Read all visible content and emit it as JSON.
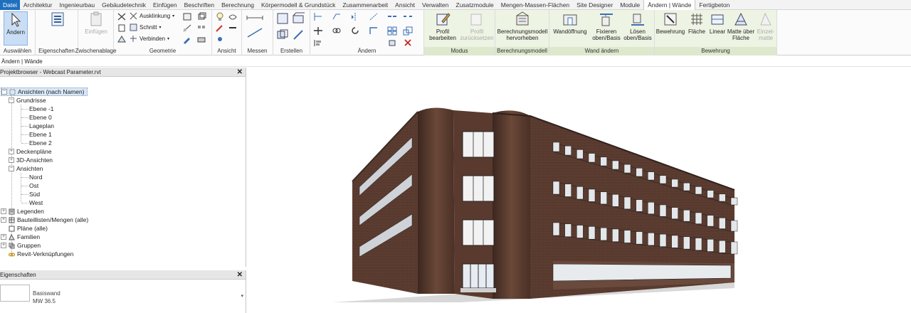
{
  "menu_tabs": [
    "Datei",
    "Architektur",
    "Ingenieurbau",
    "Gebäudetechnik",
    "Einfügen",
    "Beschriften",
    "Berechnung",
    "Körpermodell & Grundstück",
    "Zusammenarbeit",
    "Ansicht",
    "Verwalten",
    "Zusatzmodule",
    "Mengen-Massen-Flächen",
    "Site Designer",
    "Module",
    "Ändern | Wände",
    "Fertigbeton"
  ],
  "active_tab": "Ändern | Wände",
  "ribbon": {
    "select_button": "Ändern",
    "select_group": "Auswählen",
    "properties_group": "Eigenschaften",
    "paste_button": "Einfügen",
    "clipboard_group": "Zwischenablage",
    "cope_label": "Ausklinkung",
    "cut_label": "Schnitt",
    "join_label": "Verbinden",
    "geometry_group": "Geometrie",
    "view_group": "Ansicht",
    "measure_group": "Messen",
    "create_group": "Erstellen",
    "modify_group": "Ändern",
    "profile_edit": "Profil bearbeiten",
    "profile_reset": "Profil zurücksetzen",
    "mode_group": "Modus",
    "analytical_highlight": "Berechnungsmodell hervorheben",
    "analytical_group": "Berechnungsmodell",
    "wall_opening": "Wandöffnung",
    "attach_top": "Fixieren oben/Basis",
    "detach_top": "Lösen oben/Basis",
    "modify_wall_group": "Wand ändern",
    "rebar": "Bewehrung",
    "area": "Fläche",
    "linear": "Linear",
    "mat_over_area": "Matte über Fläche",
    "single_mat": "Einzel- matte",
    "rebar_group": "Bewehrung"
  },
  "options_bar": "Ändern | Wände",
  "project_browser": {
    "title": "Projektbrowser - Webcast Parameter.rvt",
    "root": "Ansichten (nach Namen)",
    "grundrisse": "Grundrisse",
    "grundrisse_items": [
      "Ebene -1",
      "Ebene 0",
      "Lageplan",
      "Ebene 1",
      "Ebene 2"
    ],
    "deckenplaene": "Deckenpläne",
    "ansichten_3d": "3D-Ansichten",
    "ansichten": "Ansichten",
    "ansichten_items": [
      "Nord",
      "Ost",
      "Süd",
      "West"
    ],
    "legenden": "Legenden",
    "bauteillisten": "Bauteillisten/Mengen (alle)",
    "plaene": "Pläne (alle)",
    "familien": "Familien",
    "gruppen": "Gruppen",
    "verknuepfungen": "Revit-Verknüpfungen"
  },
  "properties": {
    "title": "Eigenschaften",
    "type_family": "Basiswand",
    "type_name": "MW 36.5"
  },
  "colors": {
    "file_tab": "#1f6fbf",
    "contextual_group": "#dde8cd",
    "brick": "#5a3a2e",
    "selection": "#c9def5"
  }
}
